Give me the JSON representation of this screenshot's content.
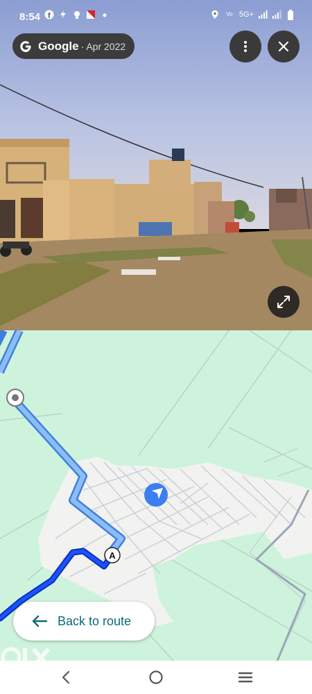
{
  "status_bar": {
    "time": "8:54",
    "network": "5G+",
    "left_icons": [
      "facebook-icon",
      "flash-icon",
      "bulb-icon",
      "flag-icon",
      "dot-icon"
    ],
    "right_icons": [
      "location-icon",
      "volte-icon",
      "signal-icon",
      "signal-icon",
      "battery-icon"
    ]
  },
  "street_view": {
    "source_brand": "Google",
    "capture_date": "· Apr 2022",
    "more_icon": "more-vert-icon",
    "close_icon": "close-icon",
    "expand_icon": "expand-icon"
  },
  "map": {
    "marker_label": "A",
    "back_to_route_label": "Back to route",
    "route_color": "#1a53ff",
    "route_alt_color": "#7fb6f5",
    "land_color": "#cdf3dc"
  },
  "watermark": "OLX",
  "navigation_bar": {
    "back_icon": "back-icon",
    "home_icon": "home-icon",
    "recents_icon": "recents-icon"
  }
}
